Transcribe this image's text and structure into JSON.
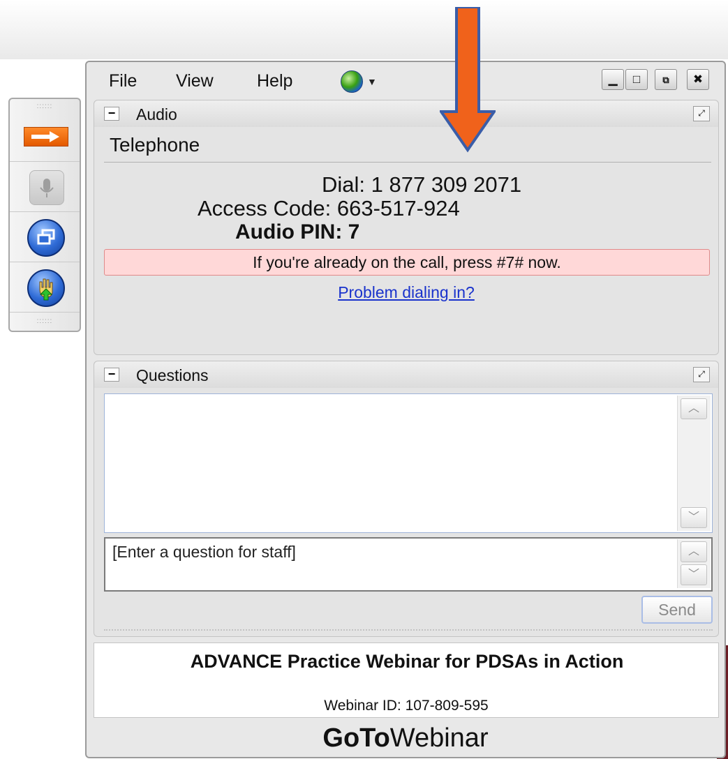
{
  "menu": {
    "file": "File",
    "view": "View",
    "help": "Help"
  },
  "icons": {
    "globe": "globe-icon",
    "minimize": "minimize-icon",
    "maximize": "maximize-icon",
    "restore": "restore-icon",
    "close": "close-icon"
  },
  "audio": {
    "title": "Audio",
    "mode": "Telephone",
    "dial": "Dial: 1 877 309 2071",
    "access_code": "Access Code: 663-517-924",
    "audio_pin": "Audio PIN: 7",
    "notice": "If you're already on the call, press #7# now.",
    "problem_link": "Problem dialing in?"
  },
  "questions": {
    "title": "Questions",
    "input_placeholder": "[Enter a question for staff]",
    "send_label": "Send"
  },
  "webinar": {
    "title": "ADVANCE Practice Webinar for PDSAs in Action",
    "id_text": "Webinar ID: 107-809-595"
  },
  "brand": {
    "goto": "GoTo",
    "webinar": "Webinar"
  },
  "colors": {
    "arrow": "#f0621b",
    "arrow_outline": "#3a5da8",
    "notice_bg": "#ffd8d8",
    "link": "#1a33cc"
  }
}
